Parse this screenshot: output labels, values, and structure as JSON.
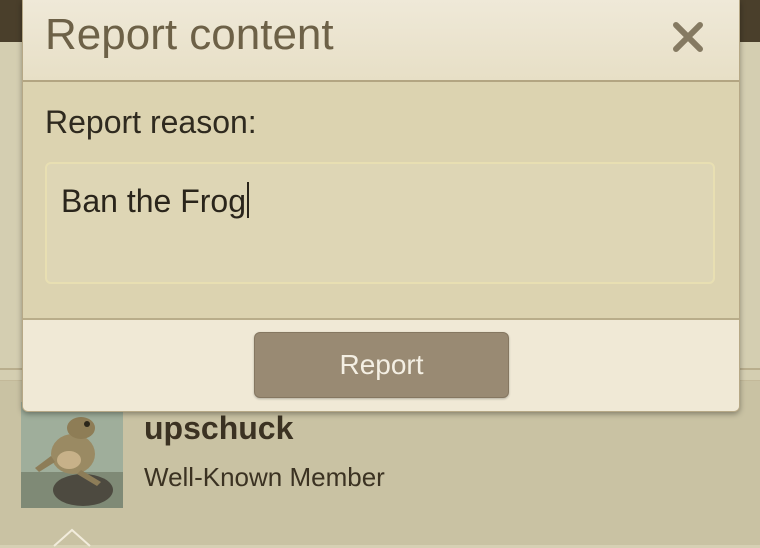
{
  "modal": {
    "title": "Report content",
    "close_icon": "close-icon",
    "reason_label": "Report reason:",
    "reason_value": "Ban the Frog",
    "report_button": "Report"
  },
  "background": {
    "username": "upschuck",
    "user_title": "Well-Known Member",
    "avatar_icon": "frog-avatar"
  },
  "colors": {
    "topbar": "#4a3f2b",
    "modal_body": "#dcd3b0",
    "modal_header": "#efe9d8",
    "button": "#998a73"
  }
}
